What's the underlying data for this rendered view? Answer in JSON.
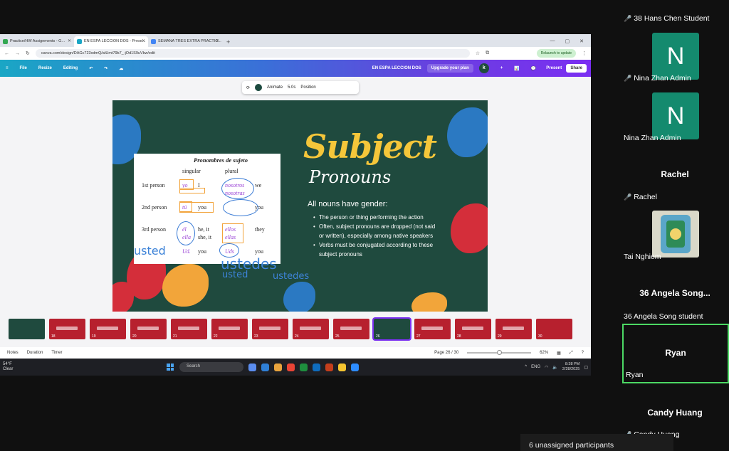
{
  "browser": {
    "tabs": [
      {
        "label": "Practice/HW Assignments - G...",
        "color": "#34a853"
      },
      {
        "label": "EN ESPA LECCION DOS - Prese...",
        "color": "#1aa6c5"
      },
      {
        "label": "SEMANA TRES EXTRA PRACTIC...",
        "color": "#4285f4"
      }
    ],
    "url": "canva.com/design/DAGc723xdmQ/atUmt79b7_-jOd1S9uVkw/edit",
    "relaunch_label": "Relaunch to update"
  },
  "canva": {
    "menu": [
      "File",
      "Resize",
      "Editing"
    ],
    "doc_title": "EN ESPA LECCION DOS",
    "upgrade_label": "Upgrade your plan",
    "avatar_letter": "k",
    "present_label": "Present",
    "share_label": "Share",
    "context": {
      "animate": "Animate",
      "duration": "5.0s",
      "position": "Position"
    },
    "bottom": {
      "notes": "Notes",
      "duration": "Duration",
      "timer": "Timer",
      "page": "Page 26 / 30",
      "zoom": "62%"
    },
    "thumbs": [
      "",
      "18",
      "19",
      "20",
      "21",
      "22",
      "23",
      "24",
      "25",
      "26",
      "27",
      "28",
      "29",
      "30"
    ],
    "active_thumb": "26"
  },
  "slide": {
    "table_title": "Pronombres de sujeto",
    "col_singular": "singular",
    "col_plural": "plural",
    "rows": [
      {
        "label": "1st person",
        "sp": "yo",
        "se": "I",
        "pp1": "nosotros",
        "pp2": "nosotras",
        "pe": "we"
      },
      {
        "label": "2nd person",
        "sp": "tú",
        "se": "you",
        "pe": "you"
      },
      {
        "label": "3rd person",
        "sp1": "él",
        "sp2": "ella",
        "se1": "he, it",
        "se2": "she, it",
        "pp1": "ellos",
        "pp2": "ellas",
        "pe": "they"
      }
    ],
    "ud": "Ud.",
    "ud_en": "you",
    "uds": "Uds",
    "uds_en": "you",
    "ink": [
      "usted",
      "ustedes",
      "usted",
      "ustedes"
    ],
    "title1": "Subject",
    "title2": "Pronouns",
    "gender_head": "All nouns have gender:",
    "bullets": [
      "The person or thing performing the action",
      "Often, subject pronouns are dropped (not said or written), especially among native speakers",
      "Verbs must be conjugated according to these subject pronouns"
    ]
  },
  "taskbar": {
    "weather_temp": "54°F",
    "weather_desc": "Clear",
    "search": "Search",
    "lang": "ENG",
    "time": "8:38 PM",
    "date": "2/28/2025"
  },
  "participants": {
    "p1": "38 Hans Chen Student",
    "p2_avatar": "N",
    "p2": "Nina Zhan Admin",
    "p3_avatar": "N",
    "p3": "Nina Zhan Admin",
    "p4_big": "Rachel",
    "p4": "Rachel",
    "p5": "Tai Nghiem",
    "p6_big": "36 Angela Song...",
    "p6": "36 Angela Song student",
    "p7_big": "Ryan",
    "p7": "Ryan",
    "p8_big": "Candy Huang",
    "p8": "Candy Huang",
    "unassigned": "6 unassigned participants"
  },
  "colors": {
    "slide_bg": "#1f4a3e",
    "accent_yellow": "#f5c63a",
    "active_speaker": "#4cd964",
    "muted_mic": "#e8433b"
  }
}
